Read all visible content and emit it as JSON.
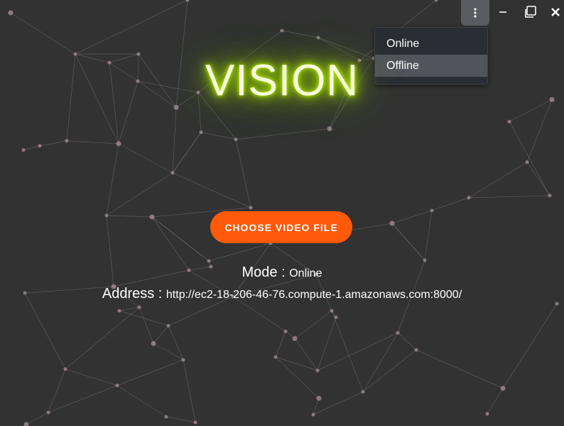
{
  "window": {
    "menu_icon": "vertical-ellipsis-icon",
    "minimize_icon": "minimize-icon",
    "maximize_icon": "restore-icon",
    "close_icon": "close-icon"
  },
  "mode_menu": {
    "options": [
      "Online",
      "Offline"
    ],
    "highlighted": "Offline"
  },
  "app": {
    "title": "VISION",
    "choose_button_label": "CHOOSE VIDEO FILE",
    "mode_label": "Mode : ",
    "mode_value": "Online",
    "address_label": "Address : ",
    "address_value": "http://ec2-18-206-46-76.compute-1.amazonaws.com:8000/"
  },
  "colors": {
    "background": "#323232",
    "accent_button": "#ff5a0a",
    "title_glow": "#c6ff00",
    "menu_background": "#2a2d33",
    "menu_highlight": "#51545a"
  }
}
